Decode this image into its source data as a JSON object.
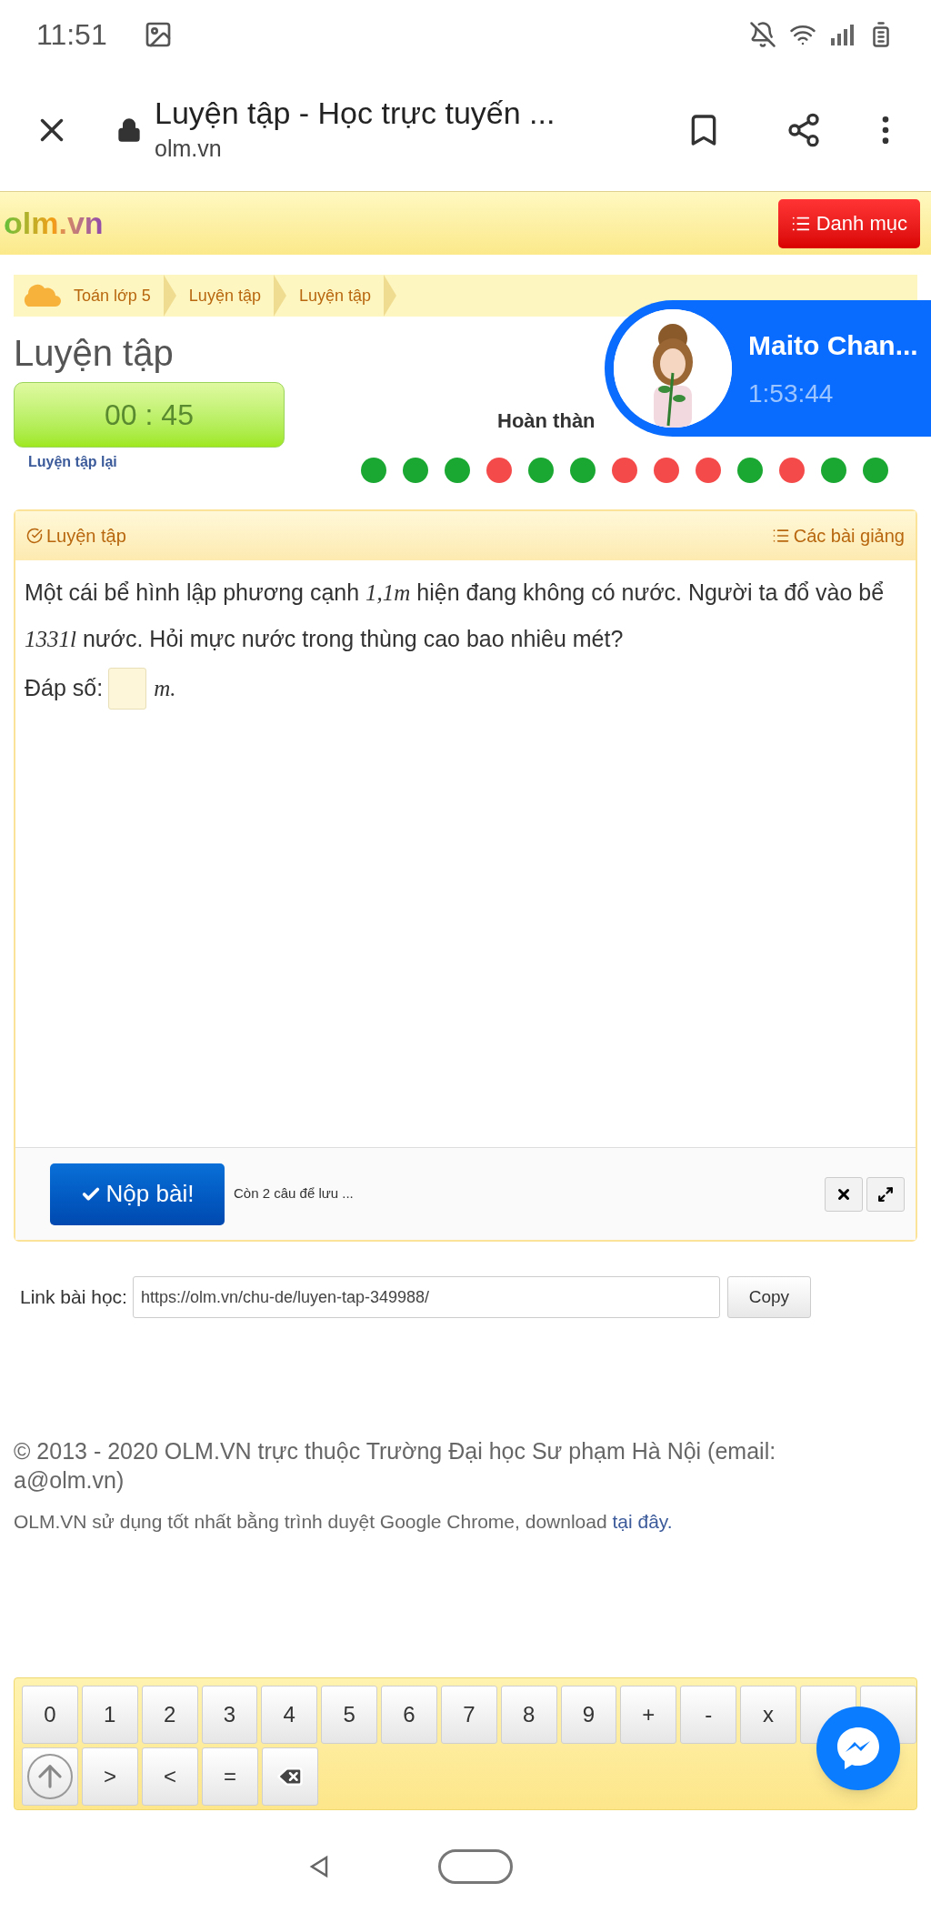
{
  "status_bar": {
    "time": "11:51"
  },
  "browser": {
    "title": "Luyện tập - Học trực tuyến ...",
    "url": "olm.vn"
  },
  "site_header": {
    "logo": "olm.vn",
    "menu_button": "Danh mục"
  },
  "breadcrumb": [
    "Toán lớp 5",
    "Luyện tập",
    "Luyện tập"
  ],
  "page_title": "Luyện tập",
  "timer": "00 : 45",
  "retry_link": "Luyện tập lại",
  "progress": {
    "label": "Hoàn thàn",
    "dots": [
      {
        "color": "#1aa832"
      },
      {
        "color": "#1aa832"
      },
      {
        "color": "#1aa832"
      },
      {
        "color": "#f44a4a"
      },
      {
        "color": "#1aa832"
      },
      {
        "color": "#1aa832"
      },
      {
        "color": "#f44a4a"
      },
      {
        "color": "#f44a4a"
      },
      {
        "color": "#f44a4a"
      },
      {
        "color": "#1aa832"
      },
      {
        "color": "#f44a4a"
      },
      {
        "color": "#1aa832"
      },
      {
        "color": "#1aa832"
      }
    ]
  },
  "chat_head": {
    "name": "Maito Chan...",
    "time": "1:53:44"
  },
  "card": {
    "title": "Luyện tập",
    "lessons_link": "Các bài giảng",
    "question": [
      {
        "kind": "text",
        "text": "Một cái bể hình lập phương cạnh "
      },
      {
        "kind": "math",
        "text": "1,1m"
      },
      {
        "kind": "text",
        "text": " hiện đang không có nước. Người ta đổ vào bể "
      },
      {
        "kind": "math",
        "text": "1331l"
      },
      {
        "kind": "text",
        "text": " nước. Hỏi mực nước trong thùng cao bao nhiêu mét?"
      }
    ],
    "answer_label": "Đáp số:",
    "answer_unit": "m.",
    "submit_button": "Nộp bài!",
    "save_note": "Còn 2 câu để lưu ..."
  },
  "link_row": {
    "label": "Link bài học:",
    "value": "https://olm.vn/chu-de/luyen-tap-349988/",
    "copy_button": "Copy"
  },
  "footer": {
    "copyright": "© 2013 - 2020 OLM.VN trực thuộc Trường Đại học Sư phạm Hà Nội (email: a@olm.vn)",
    "browser_note": "OLM.VN sử dụng tốt nhất bằng trình duyệt Google Chrome, download",
    "download_link": "tại đây."
  },
  "keypad": {
    "row_1": [
      {
        "label": "0"
      },
      {
        "label": "1"
      },
      {
        "label": "2"
      },
      {
        "label": "3"
      },
      {
        "label": "4"
      },
      {
        "label": "5"
      },
      {
        "label": "6"
      },
      {
        "label": "7"
      },
      {
        "label": "8"
      },
      {
        "label": "9"
      },
      {
        "label": "+"
      },
      {
        "label": "-"
      },
      {
        "label": "x"
      }
    ],
    "row_2": [
      {
        "kind": "toggle"
      },
      {
        "kind": "text",
        "label": ">"
      },
      {
        "kind": "text",
        "label": "<"
      },
      {
        "kind": "text",
        "label": "="
      },
      {
        "kind": "backspace"
      }
    ]
  }
}
